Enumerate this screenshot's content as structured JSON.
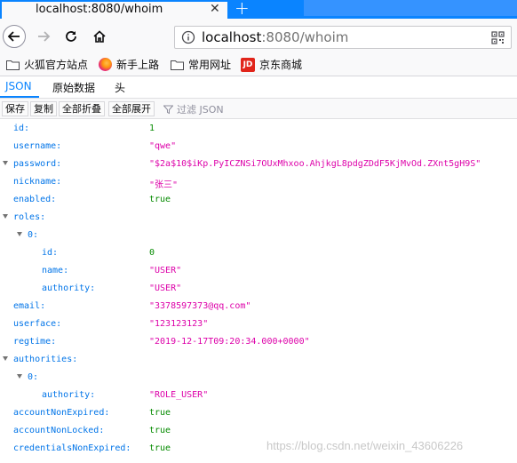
{
  "browser": {
    "tab_title": "localhost:8080/whoim",
    "url_host": "localhost",
    "url_rest": ":8080/whoim"
  },
  "bookmarks": [
    {
      "label": "火狐官方站点",
      "icon": "folder-icon"
    },
    {
      "label": "新手上路",
      "icon": "firefox-icon"
    },
    {
      "label": "常用网址",
      "icon": "folder-icon"
    },
    {
      "label": "京东商城",
      "icon": "jd-icon",
      "badge": "JD"
    }
  ],
  "viewer": {
    "tabs": [
      "JSON",
      "原始数据",
      "头"
    ],
    "toolbar": [
      "保存",
      "复制",
      "全部折叠",
      "全部展开"
    ],
    "filter_placeholder": "过滤 JSON"
  },
  "json_rows": [
    {
      "key": "id:",
      "value": "1",
      "type": "num",
      "indent": 0
    },
    {
      "key": "username:",
      "value": "\"qwe\"",
      "type": "str",
      "indent": 0
    },
    {
      "key": "password:",
      "value": "\"$2a$10$iKp.PyICZNSi7OUxMhxoo.AhjkgL8pdgZDdF5KjMvOd.ZXnt5gH9S\"",
      "type": "str",
      "indent": 0,
      "toggle": true
    },
    {
      "key": "nickname:",
      "value": "\"张三\"",
      "type": "str",
      "indent": 0
    },
    {
      "key": "enabled:",
      "value": "true",
      "type": "bool",
      "indent": 0
    },
    {
      "key": "roles:",
      "value": "",
      "type": "obj",
      "indent": 0,
      "toggle": true
    },
    {
      "key": "0:",
      "value": "",
      "type": "obj",
      "indent": 1,
      "toggle": true
    },
    {
      "key": "id:",
      "value": "0",
      "type": "num",
      "indent": 2
    },
    {
      "key": "name:",
      "value": "\"USER\"",
      "type": "str",
      "indent": 2
    },
    {
      "key": "authority:",
      "value": "\"USER\"",
      "type": "str",
      "indent": 2
    },
    {
      "key": "email:",
      "value": "\"3378597373@qq.com\"",
      "type": "str",
      "indent": 0
    },
    {
      "key": "userface:",
      "value": "\"123123123\"",
      "type": "str",
      "indent": 0
    },
    {
      "key": "regtime:",
      "value": "\"2019-12-17T09:20:34.000+0000\"",
      "type": "str",
      "indent": 0
    },
    {
      "key": "authorities:",
      "value": "",
      "type": "obj",
      "indent": 0,
      "toggle": true
    },
    {
      "key": "0:",
      "value": "",
      "type": "obj",
      "indent": 1,
      "toggle": true
    },
    {
      "key": "authority:",
      "value": "\"ROLE_USER\"",
      "type": "str",
      "indent": 2
    },
    {
      "key": "accountNonExpired:",
      "value": "true",
      "type": "bool",
      "indent": 0
    },
    {
      "key": "accountNonLocked:",
      "value": "true",
      "type": "bool",
      "indent": 0
    },
    {
      "key": "credentialsNonExpired:",
      "value": "true",
      "type": "bool",
      "indent": 0
    }
  ],
  "watermark": "https://blog.csdn.net/weixin_43606226",
  "colors": {
    "accent": "#0a84ff",
    "key": "#0074e8",
    "string": "#dd00a9",
    "number": "#058b00"
  }
}
